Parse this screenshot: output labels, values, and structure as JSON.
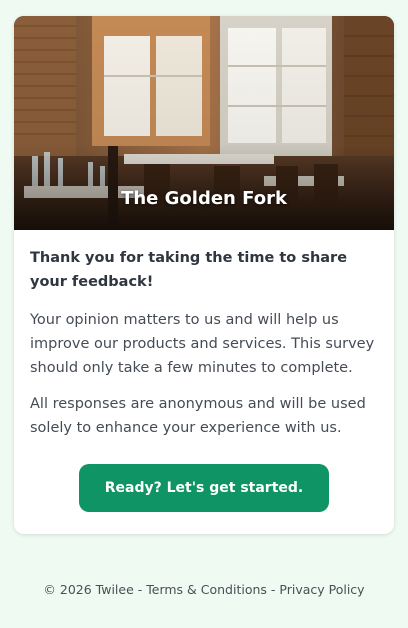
{
  "restaurant": {
    "name": "The Golden Fork"
  },
  "intro": {
    "lead": "Thank you for taking the time to share your feedback!",
    "paragraph1": "Your opinion matters to us and will help us improve our products and services. This survey should only take a few minutes to complete.",
    "paragraph2": "All responses are anonymous and will be used solely to enhance your experience with us."
  },
  "actions": {
    "start_label": "Ready? Let's get started."
  },
  "footer": {
    "copyright": "© 2026 Twilee",
    "separator": " - ",
    "terms_label": "Terms & Conditions",
    "privacy_label": "Privacy Policy"
  },
  "colors": {
    "page_background": "#eefaf2",
    "accent": "#0e9465",
    "card_background": "#ffffff"
  }
}
